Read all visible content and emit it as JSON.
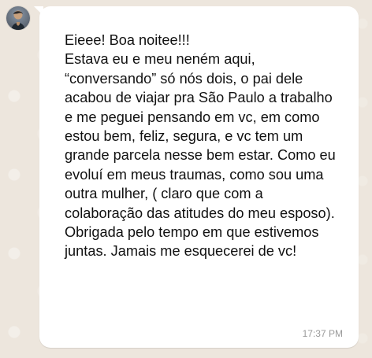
{
  "message": {
    "text": "Eieee! Boa noitee!!!\nEstava eu e meu neném aqui, “conversando” só nós dois, o pai dele acabou de viajar pra São Paulo a trabalho e me peguei pensando em vc, em como estou bem, feliz, segura, e vc tem um grande parcela nesse bem estar. Como eu evoluí em meus traumas, como sou uma outra mulher, ( claro que com a colaboração das atitudes do meu esposo). Obrigada pelo tempo em que estivemos juntas. Jamais me esquecerei de vc!",
    "time": "17:37 PM"
  },
  "colors": {
    "background": "#efeae2",
    "bubble": "#ffffff",
    "text": "#111111",
    "timestamp": "#9a9a9a"
  }
}
